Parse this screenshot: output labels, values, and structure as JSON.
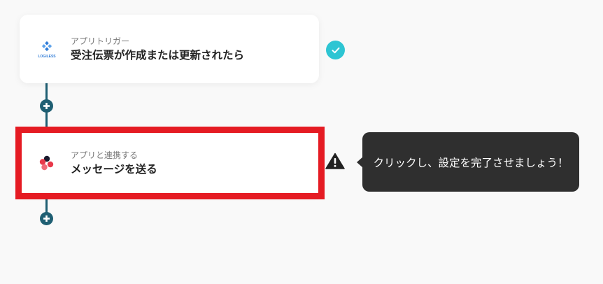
{
  "flow": {
    "trigger": {
      "subtitle": "アプリトリガー",
      "title": "受注伝票が作成または更新されたら",
      "logo_text": "LOGILESS",
      "status": "completed"
    },
    "action": {
      "subtitle": "アプリと連携する",
      "title": "メッセージを送る",
      "status": "warning"
    }
  },
  "tooltip": {
    "text": "クリックし、設定を完了させましょう！"
  },
  "colors": {
    "connector": "#1f5f73",
    "check": "#2ec5d3",
    "highlight": "#e51b23",
    "tooltip_bg": "#2f2f2f",
    "logiless_blue": "#2f7bd6"
  },
  "icons": {
    "add": "plus-icon",
    "done": "check-icon",
    "warning": "warning-icon"
  }
}
